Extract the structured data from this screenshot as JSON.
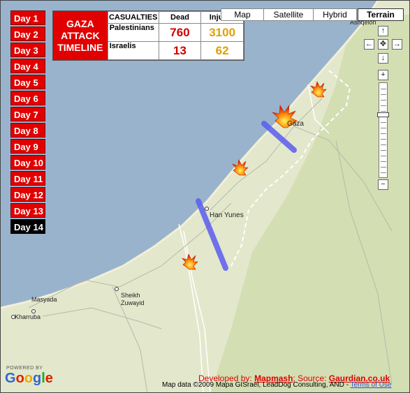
{
  "days": [
    "Day 1",
    "Day 2",
    "Day 3",
    "Day 4",
    "Day 5",
    "Day 6",
    "Day 7",
    "Day 8",
    "Day 9",
    "Day 10",
    "Day 11",
    "Day 12",
    "Day 13",
    "Day 14"
  ],
  "active_day": "Day 14",
  "panel": {
    "title_lines": [
      "GAZA",
      "ATTACK",
      "TIMELINE"
    ],
    "header_casualties": "CASUALTIES",
    "header_dead": "Dead",
    "header_injured": "Injured",
    "rows": [
      {
        "label": "Palestinians",
        "dead": "760",
        "injured": "3100"
      },
      {
        "label": "Israelis",
        "dead": "13",
        "injured": "62"
      }
    ]
  },
  "map_types": {
    "map": "Map",
    "satellite": "Satellite",
    "hybrid": "Hybrid",
    "terrain": "Terrain"
  },
  "nav": {
    "up": "↑",
    "down": "↓",
    "left": "←",
    "right": "→",
    "center": "✥",
    "zoom_in": "+",
    "zoom_out": "−"
  },
  "places": {
    "gaza": "Gaza",
    "han_yunes": "Han Yunes",
    "sheikh": "Sheikh",
    "zuwayid": "Zuwayid",
    "masyada": "Masyada",
    "kharruba": "Kharruba",
    "ashqelon": "Ashqelon"
  },
  "footer": {
    "powered_by": "POWERED BY",
    "google": "Google",
    "developed_by": "Developed by: ",
    "mapmash": "Mapmash",
    "source": "; Source: ",
    "gaurdian": "Gaurdian.co.uk",
    "map_data": "Map data ©2009 Mapa GISrael, LeadDog Consulting, AND - ",
    "terms": "Terms of Use"
  },
  "colors": {
    "red": "#e00000",
    "sea": "#99b3cc",
    "land": "#dfe6c4",
    "strike_line": "#5a5af0",
    "injured": "#e0a000"
  }
}
